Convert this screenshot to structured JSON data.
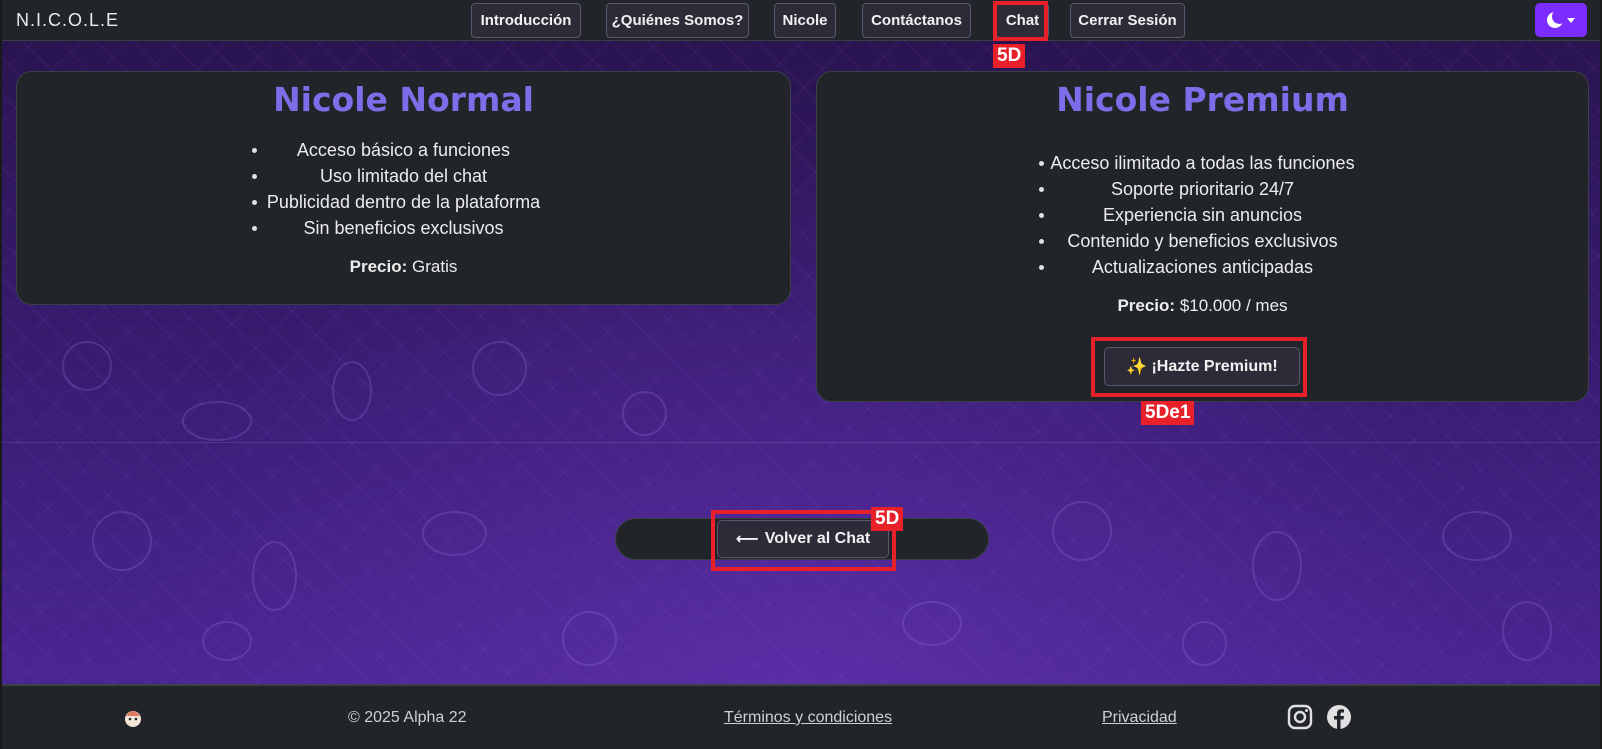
{
  "nav": {
    "brand": "N.I.C.O.L.E",
    "items": [
      {
        "label": "Introducción"
      },
      {
        "label": "¿Quiénes Somos?"
      },
      {
        "label": "Nicole"
      },
      {
        "label": "Contáctanos"
      },
      {
        "label": "Chat"
      },
      {
        "label": "Cerrar Sesión"
      }
    ],
    "theme_icon": "moon-icon"
  },
  "plans": {
    "normal": {
      "title": "Nicole Normal",
      "features": [
        "Acceso básico a funciones",
        "Uso limitado del chat",
        "Publicidad dentro de la plataforma",
        "Sin beneficios exclusivos"
      ],
      "price_label": "Precio:",
      "price_value": "Gratis"
    },
    "premium": {
      "title": "Nicole Premium",
      "features": [
        "Acceso ilimitado a todas las funciones",
        "Soporte prioritario 24/7",
        "Experiencia sin anuncios",
        "Contenido y beneficios exclusivos",
        "Actualizaciones anticipadas"
      ],
      "price_label": "Precio:",
      "price_value": "$10.000 / mes",
      "cta_icon": "✨",
      "cta_label": "¡Hazte Premium!"
    }
  },
  "back": {
    "arrow": "⟵",
    "label": "Volver al Chat"
  },
  "annotations": {
    "chat_tag": "5D",
    "premium_tag": "5De1",
    "back_tag": "5D"
  },
  "footer": {
    "copyright": "© 2025 Alpha 22",
    "terms": "Términos y condiciones",
    "privacy": "Privacidad",
    "icons": [
      "instagram-icon",
      "facebook-icon"
    ]
  },
  "colors": {
    "accent": "#7b6ee8",
    "theme_button": "#7c2cff",
    "annotation": "#e8202a"
  }
}
